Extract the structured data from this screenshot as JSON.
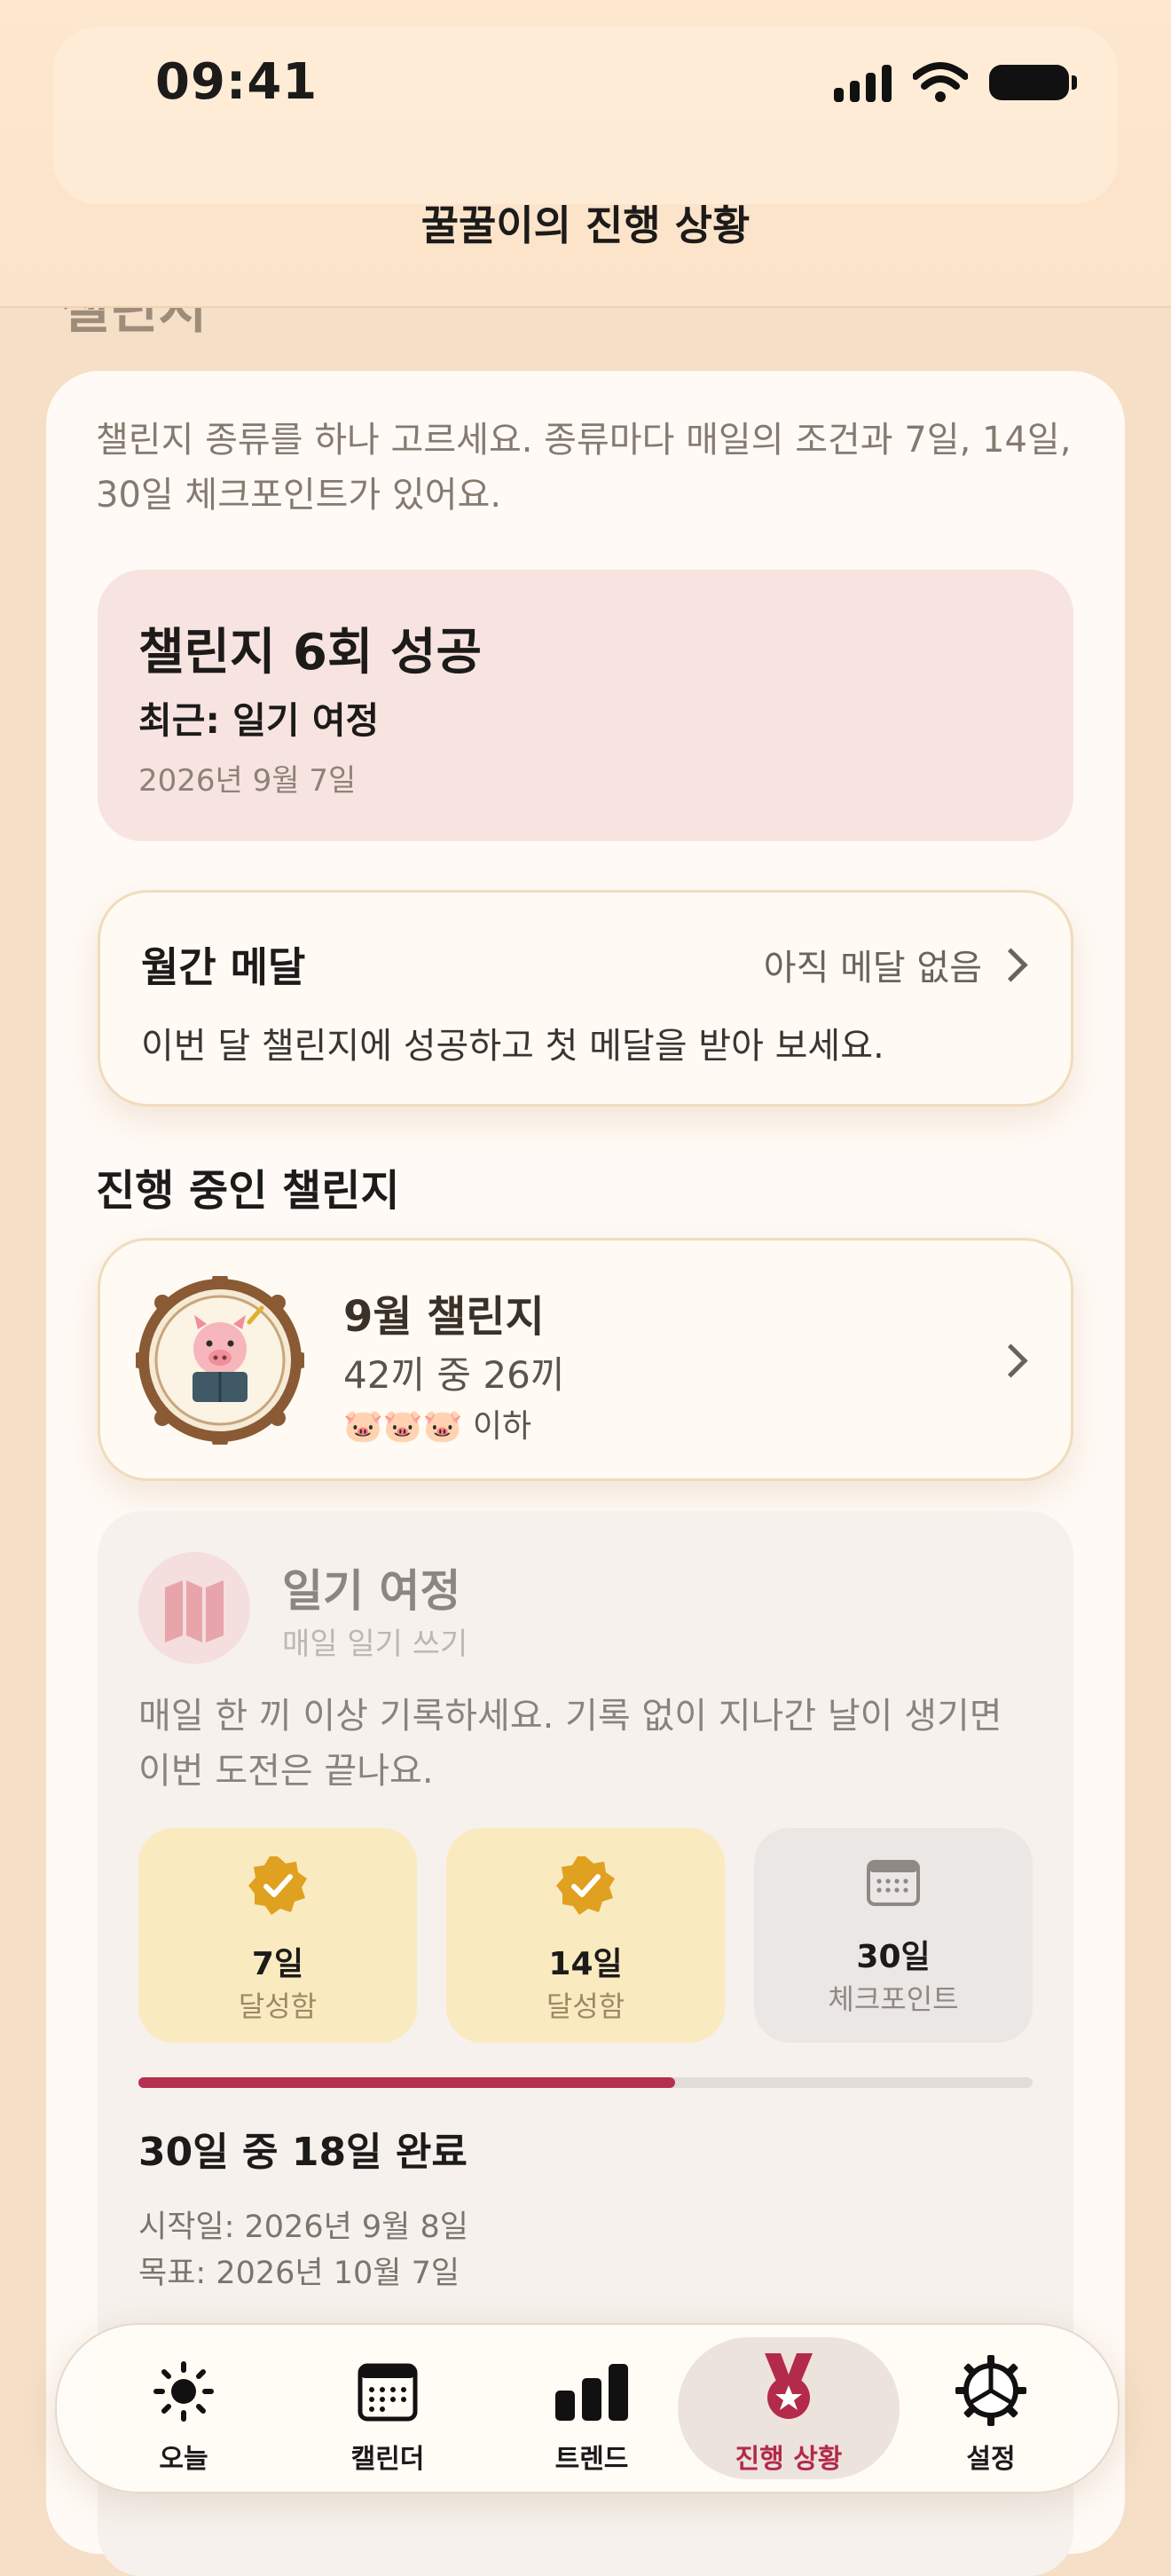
{
  "status_bar": {
    "time": "09:41"
  },
  "nav": {
    "title": "꿀꿀이의 진행 상황",
    "section_peek": "챌린지"
  },
  "intro": "챌린지 종류를 하나 고르세요. 종류마다 매일의 조건과 7일, 14일, 30일 체크포인트가 있어요.",
  "success_card": {
    "title": "챌린지 6회 성공",
    "recent": "최근: 일기 여정",
    "date": "2026년 9월 7일"
  },
  "medal_card": {
    "title": "월간 메달",
    "status": "아직 메달 없음",
    "description": "이번 달 챌린지에 성공하고 첫 메달을 받아 보세요."
  },
  "active_section": {
    "heading": "진행 중인 챌린지"
  },
  "active_challenge": {
    "title": "9월 챌린지",
    "progress": "42끼 중 26끼",
    "pigs": "🐷🐷🐷 이하",
    "badge_icon": "pig-reading-badge-icon"
  },
  "journey": {
    "title": "일기 여정",
    "subtitle": "매일 일기 쓰기",
    "description": "매일 한 끼 이상 기록하세요. 기록 없이 지나간 날이 생기면 이번 도전은 끝나요.",
    "icon": "map-icon",
    "checkpoints": [
      {
        "day": "7일",
        "state": "달성함",
        "achieved": true
      },
      {
        "day": "14일",
        "state": "달성함",
        "achieved": true
      },
      {
        "day": "30일",
        "state": "체크포인트",
        "achieved": false
      }
    ],
    "progress_fraction": 0.6,
    "completed_text": "30일 중 18일 완료",
    "start_text": "시작일: 2026년 9월 8일",
    "goal_text": "목표: 2026년 10월 7일"
  },
  "tabs": [
    {
      "label": "오늘",
      "icon": "sun-icon",
      "active": false
    },
    {
      "label": "캘린더",
      "icon": "calendar-icon",
      "active": false
    },
    {
      "label": "트렌드",
      "icon": "bar-chart-icon",
      "active": false
    },
    {
      "label": "진행 상황",
      "icon": "medal-icon",
      "active": true
    },
    {
      "label": "설정",
      "icon": "gear-icon",
      "active": false
    }
  ],
  "colors": {
    "background": "#f5dfc6",
    "accent": "#b4304e",
    "checkpoint_done": "#faeac0",
    "checkpoint_badge": "#e0a020"
  }
}
